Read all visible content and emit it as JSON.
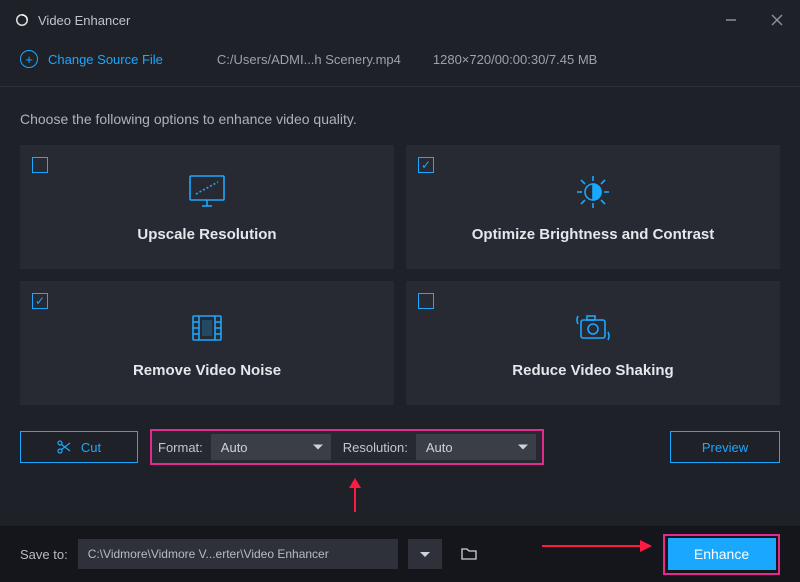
{
  "app": {
    "title": "Video Enhancer"
  },
  "source": {
    "change_label": "Change Source File",
    "path": "C:/Users/ADMI...h Scenery.mp4",
    "info": "1280×720/00:00:30/7.45 MB"
  },
  "subtitle": "Choose the following options to enhance video quality.",
  "cards": [
    {
      "label": "Upscale Resolution",
      "checked": false
    },
    {
      "label": "Optimize Brightness and Contrast",
      "checked": true
    },
    {
      "label": "Remove Video Noise",
      "checked": true
    },
    {
      "label": "Reduce Video Shaking",
      "checked": false
    }
  ],
  "options": {
    "cut_label": "Cut",
    "format_label": "Format:",
    "format_value": "Auto",
    "resolution_label": "Resolution:",
    "resolution_value": "Auto",
    "preview_label": "Preview"
  },
  "bottom": {
    "save_to_label": "Save to:",
    "save_path": "C:\\Vidmore\\Vidmore V...erter\\Video Enhancer",
    "enhance_label": "Enhance"
  },
  "colors": {
    "accent": "#1aa8ff",
    "highlight": "#e52a8d"
  }
}
